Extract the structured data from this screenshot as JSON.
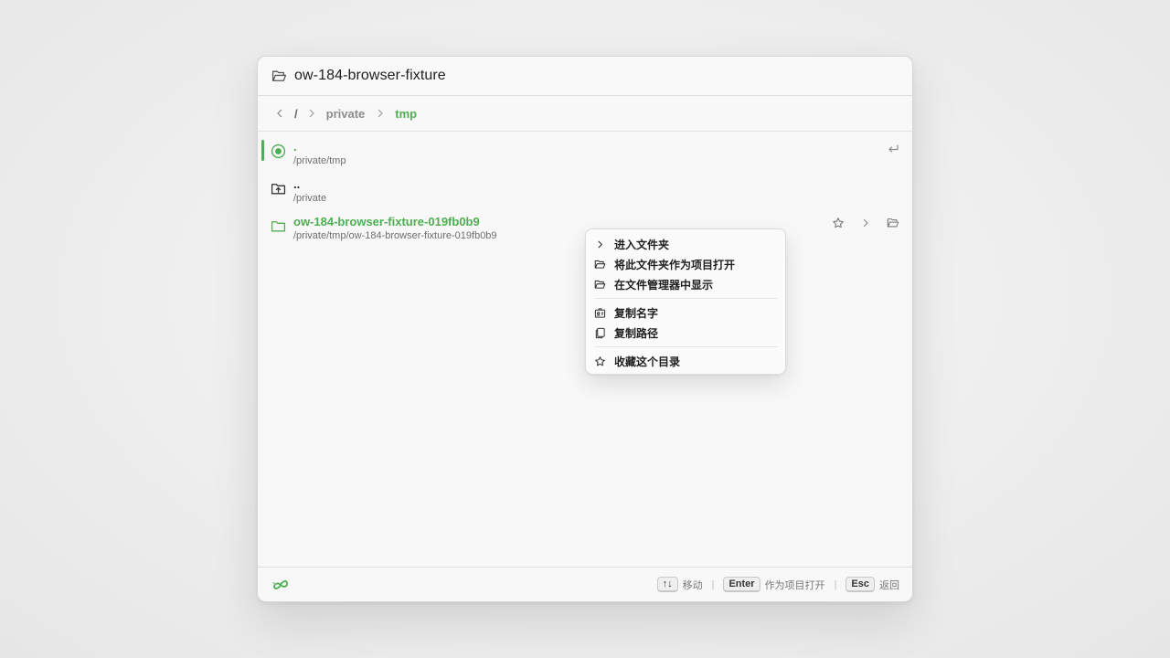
{
  "window": {
    "title": "ow-184-browser-fixture"
  },
  "breadcrumb": {
    "root": "/",
    "segments": [
      "private",
      "tmp"
    ]
  },
  "list": [
    {
      "name": ".",
      "path": "/private/tmp",
      "icon": "radio-selected-icon"
    },
    {
      "name": "..",
      "path": "/private",
      "icon": "folder-up-icon"
    },
    {
      "name": "ow-184-browser-fixture-019fb0b9",
      "path": "/private/tmp/ow-184-browser-fixture-019fb0b9",
      "icon": "folder-icon"
    }
  ],
  "context_menu": {
    "items": [
      {
        "label": "进入文件夹",
        "icon": "chevron-right-icon"
      },
      {
        "label": "将此文件夹作为项目打开",
        "icon": "folder-open-icon"
      },
      {
        "label": "在文件管理器中显示",
        "icon": "folder-open-icon"
      },
      {
        "label": "复制名字",
        "icon": "badge-icon"
      },
      {
        "label": "复制路径",
        "icon": "copy-icon"
      },
      {
        "label": "收藏这个目录",
        "icon": "star-icon"
      }
    ]
  },
  "footer": {
    "hints": [
      {
        "key": "↑↓",
        "label": "移动"
      },
      {
        "key": "Enter",
        "label": "作为项目打开"
      },
      {
        "key": "Esc",
        "label": "返回"
      }
    ]
  },
  "colors": {
    "accent": "#4caf50",
    "text": "#222222",
    "muted": "#6e6e6e"
  }
}
